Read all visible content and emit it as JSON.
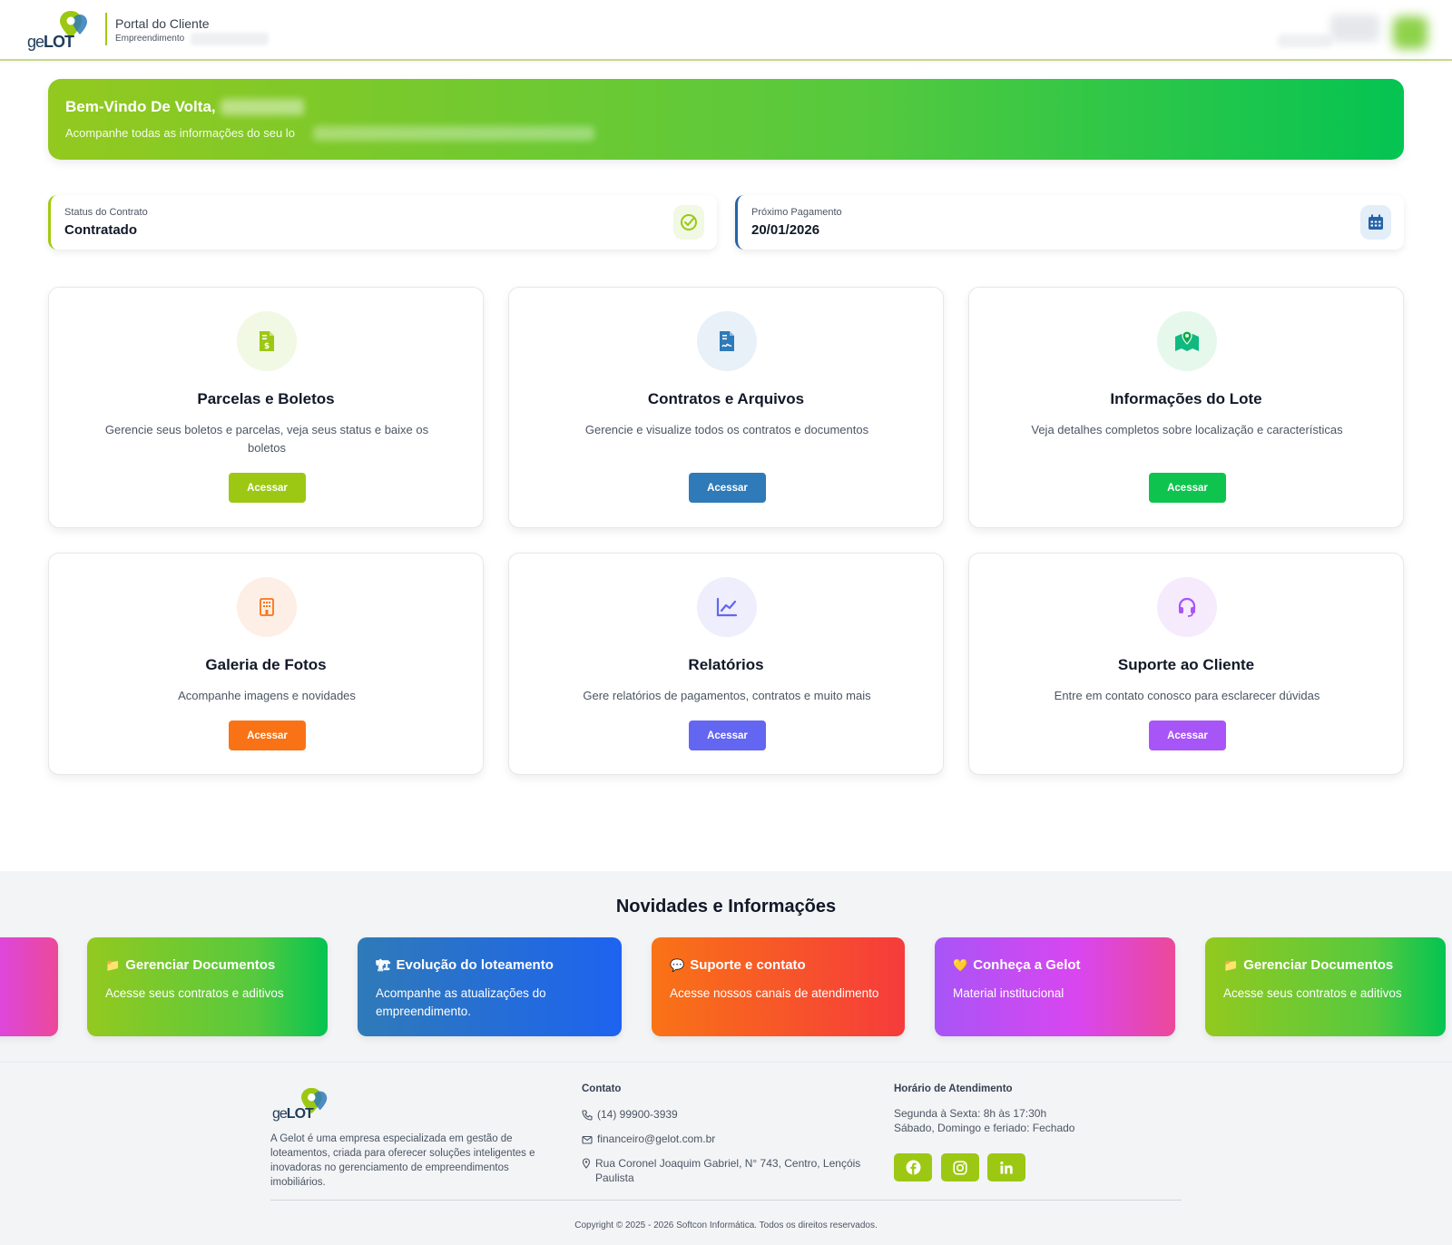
{
  "header": {
    "logo_text_ge": "ge",
    "logo_text_lot": "LOT",
    "portal_title": "Portal do Cliente",
    "portal_subtitle": "Empreendimento"
  },
  "banner": {
    "title": "Bem-Vindo De Volta,",
    "text": "Acompanhe todas as informações do seu lo"
  },
  "status": {
    "contract_label": "Status do Contrato",
    "contract_value": "Contratado",
    "payment_label": "Próximo Pagamento",
    "payment_value": "20/01/2026"
  },
  "cards": [
    {
      "title": "Parcelas e Boletos",
      "desc": "Gerencie seus boletos e parcelas, veja seus status e baixe os boletos",
      "button": "Acessar",
      "icon": "invoice-dollar-icon",
      "color": "#9cc813",
      "bg": "#f1f8e4"
    },
    {
      "title": "Contratos e Arquivos",
      "desc": "Gerencie e visualize todos os contratos e documentos",
      "button": "Acessar",
      "icon": "contract-file-icon",
      "color": "#2f7ab8",
      "bg": "#e8f0f8"
    },
    {
      "title": "Informações do Lote",
      "desc": "Veja detalhes completos sobre localização e características",
      "button": "Acessar",
      "icon": "map-location-icon",
      "color": "#0ec44f",
      "bg": "#e6f8ec"
    },
    {
      "title": "Galeria de Fotos",
      "desc": "Acompanhe imagens e novidades",
      "button": "Acessar",
      "icon": "building-icon",
      "color": "#f97316",
      "bg": "#fdefe6"
    },
    {
      "title": "Relatórios",
      "desc": "Gere relatórios de pagamentos, contratos e muito mais",
      "button": "Acessar",
      "icon": "chart-line-icon",
      "color": "#6366f1",
      "bg": "#eeeefc"
    },
    {
      "title": "Suporte ao Cliente",
      "desc": "Entre em contato conosco para esclarecer dúvidas",
      "button": "Acessar",
      "icon": "headset-icon",
      "color": "#a855f7",
      "bg": "#f5ebfd"
    }
  ],
  "news": {
    "title": "Novidades e Informações",
    "items": [
      {
        "title": "Gerenciar Documentos",
        "desc": "Acesse seus contratos e aditivos",
        "emoji": "📁",
        "icon": "folder-icon"
      },
      {
        "title": "Evolução do loteamento",
        "desc": "Acompanhe as atualizações do empreendimento.",
        "emoji": "🏗",
        "icon": "construction-icon"
      },
      {
        "title": "Suporte e contato",
        "desc": "Acesse nossos canais de atendimento",
        "emoji": "💬",
        "icon": "chat-icon"
      },
      {
        "title": "Conheça a Gelot",
        "desc": "Material institucional",
        "emoji": "💛",
        "icon": "heart-icon"
      },
      {
        "title": "Gerenciar Documentos",
        "desc": "Acesse seus contratos e aditivos",
        "emoji": "📁",
        "icon": "folder-icon"
      }
    ]
  },
  "footer": {
    "about": "A Gelot é uma empresa especializada em gestão de loteamentos, criada para oferecer soluções inteligentes e inovadoras no gerenciamento de empreendimentos imobiliários.",
    "contact_heading": "Contato",
    "phone": "(14) 99900-3939",
    "email": "financeiro@gelot.com.br",
    "address": "Rua Coronel Joaquim Gabriel, N° 743, Centro, Lençóis Paulista",
    "hours_heading": "Horário de Atendimento",
    "hours_weekdays": "Segunda à Sexta: 8h às 17:30h",
    "hours_weekend": "Sábado, Domingo e feriado: Fechado",
    "copyright": "Copyright © 2025 - 2026 Softcon Informática. Todos os direitos reservados."
  },
  "colors": {
    "brand_green": "#9cc813",
    "brand_blue": "#2563a8"
  }
}
